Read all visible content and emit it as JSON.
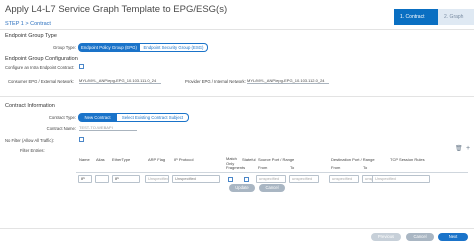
{
  "header": {
    "title": "Apply L4-L7 Service Graph Template to EPG/ESG(s)",
    "step_label": "STEP 1 > Contract",
    "wizard": [
      {
        "label": "1. Contract"
      },
      {
        "label": "2. Graph"
      }
    ]
  },
  "epg_section": {
    "heading": "Endpoint Group Type",
    "group_type_label": "Group Type:",
    "options": [
      "Endpoint Policy Group (EPG)",
      "Endpoint Security Group (ESG)"
    ],
    "selected": "Endpoint Policy Group (EPG)"
  },
  "epg_config": {
    "heading": "Endpoint Group Configuration",
    "intra_label": "Configure an Intra Endpoint Contract:",
    "consumer_label": "Consumer EPG / External Network:",
    "consumer_value": "MYL/MYL_ANP/epg-EPG_10.103.111.0_24",
    "provider_label": "Provider EPG / Internal Network:",
    "provider_value": "MYL/MYL_ANP/epg-EPG_10.103.112.0_24"
  },
  "contract_info": {
    "heading": "Contract Information",
    "type_label": "Contract Type:",
    "type_options": [
      "New Contract",
      "Select Existing Contract Subject"
    ],
    "type_selected": "New Contract",
    "name_label": "Contract Name:",
    "name_value": "TEST-TO-WEBAPI",
    "nofilter_label": "No Filter (Allow All Traffic):",
    "filter_entries_label": "Filter Entries:"
  },
  "filter_table": {
    "columns": {
      "name": "Name",
      "alias": "Alias",
      "ethertype": "EtherType",
      "arp_flag": "ARP Flag",
      "ip_protocol": "IP Protocol",
      "match_only_fragments": "Match Only Fragments",
      "stateful": "Stateful",
      "source_port_range": "Source Port / Range",
      "dest_port_range": "Destination Port / Range",
      "tcp_session_rules": "TCP Session Rules",
      "from": "From",
      "to": "To"
    },
    "row": {
      "name": "IP",
      "ethertype": "IP",
      "arp_flag": "Unspecified",
      "ip_protocol": "Unspecified",
      "src_from": "unspecified",
      "src_to": "unspecified",
      "dst_from": "unspecified",
      "dst_to": "unspecified",
      "tcp_rules": "Unspecified"
    },
    "update_label": "Update",
    "cancel_label": "Cancel"
  },
  "footer": {
    "previous_label": "Previous",
    "cancel_label": "Cancel",
    "next_label": "Next"
  },
  "colors": {
    "primary": "#1a73c9",
    "wizard_active": "#0a6fc2",
    "wizard_inactive": "#dfe9f3"
  }
}
